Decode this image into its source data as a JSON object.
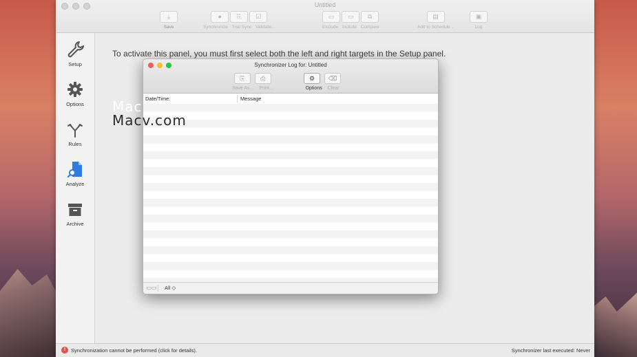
{
  "window": {
    "title": "Untitled"
  },
  "toolbar": {
    "save": "Save",
    "synchronize": "Synchronize",
    "trial_sync": "Trial Sync",
    "validate": "Validate...",
    "exclude": "Exclude",
    "include": "Include",
    "compare": "Compare",
    "add_to_schedule": "Add to Schedule...",
    "log": "Log"
  },
  "sidebar": {
    "items": [
      {
        "label": "Setup",
        "icon": "wrench-icon"
      },
      {
        "label": "Options",
        "icon": "gear-icon"
      },
      {
        "label": "Rules",
        "icon": "fork-arrows-icon"
      },
      {
        "label": "Analyze",
        "icon": "magnifier-document-icon"
      },
      {
        "label": "Archive",
        "icon": "archive-box-icon"
      }
    ]
  },
  "main": {
    "message": "To activate this panel, you must first select both the left and right targets in the Setup panel."
  },
  "watermark": {
    "ghost": "Mac",
    "text": "Macv.com"
  },
  "log_window": {
    "title": "Synchronizer Log for: Untitled",
    "toolbar": {
      "save_as": "Save As...",
      "print": "Print...",
      "options": "Options",
      "clear": "Clear"
    },
    "columns": {
      "datetime": "Date/Time:",
      "message": "Message"
    },
    "filter": "All ◇"
  },
  "status": {
    "left": "Synchronization cannot be performed (click for details).",
    "right": "Synchronizer last executed: Never"
  },
  "colors": {
    "close": "#ee5f57",
    "minimize": "#f5bf2f",
    "zoom": "#29c440",
    "accent_blue": "#2f7de1"
  }
}
